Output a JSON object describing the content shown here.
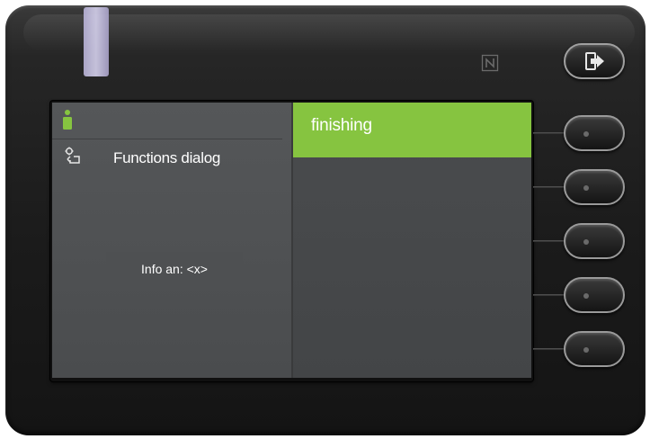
{
  "screen": {
    "left_pane": {
      "function_label": "Functions dialog",
      "info_text": "Info an: <x>"
    },
    "right_pane": {
      "menu_items": [
        {
          "label": "finishing",
          "selected": true
        }
      ]
    }
  },
  "colors": {
    "accent_green": "#86c440",
    "led": "#c9c3e6"
  },
  "icons": [
    "person-icon",
    "functions-icon",
    "nfc-icon",
    "exit-icon"
  ]
}
